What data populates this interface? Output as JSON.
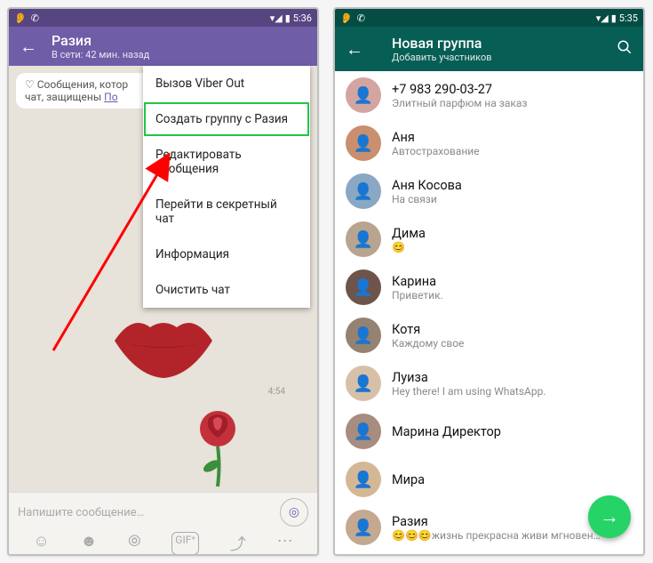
{
  "status": {
    "time": "5:36",
    "time_right": "5:35"
  },
  "viber": {
    "title": "Разия",
    "subtitle": "В сети: 42 мин. назад",
    "bubble_line1": "♡ Сообщения, котор",
    "bubble_line2": "чат, защищены",
    "bubble_link": "По",
    "menu": {
      "call": "Вызов Viber Out",
      "create_group": "Создать группу с Разия",
      "edit": "Редактировать сообщения",
      "secret": "Перейти в секретный чат",
      "info": "Информация",
      "clear": "Очистить чат"
    },
    "time1": "4:54",
    "time2": "4:54",
    "time3": "4:54",
    "input_placeholder": "Напишите сообщение…"
  },
  "wa": {
    "title": "Новая группа",
    "subtitle": "Добавить участников",
    "contacts": [
      {
        "name": "+7 983 290-03-27",
        "status": "Элитный парфюм на заказ",
        "color": "#d4a5a0"
      },
      {
        "name": "Аня",
        "status": "Автострахование",
        "color": "#c98f6e"
      },
      {
        "name": "Аня Косова",
        "status": "На связи",
        "color": "#8aa8c4"
      },
      {
        "name": "Дима",
        "status": "😊",
        "color": "#b8a48f"
      },
      {
        "name": "Карина",
        "status": "Приветик.",
        "color": "#6e544a"
      },
      {
        "name": "Котя",
        "status": "Каждому свое",
        "color": "#968270"
      },
      {
        "name": "Луиза",
        "status": "Hey there! I am using WhatsApp.",
        "color": "#d8c0a8"
      },
      {
        "name": "Марина Директор",
        "status": "",
        "color": "#a88c7e"
      },
      {
        "name": "Мира",
        "status": "",
        "color": "#d4b896"
      },
      {
        "name": "Разия",
        "status": "😊😊😊жизнь прекрасна живи мгновен…",
        "color": "#c4a890"
      }
    ]
  }
}
